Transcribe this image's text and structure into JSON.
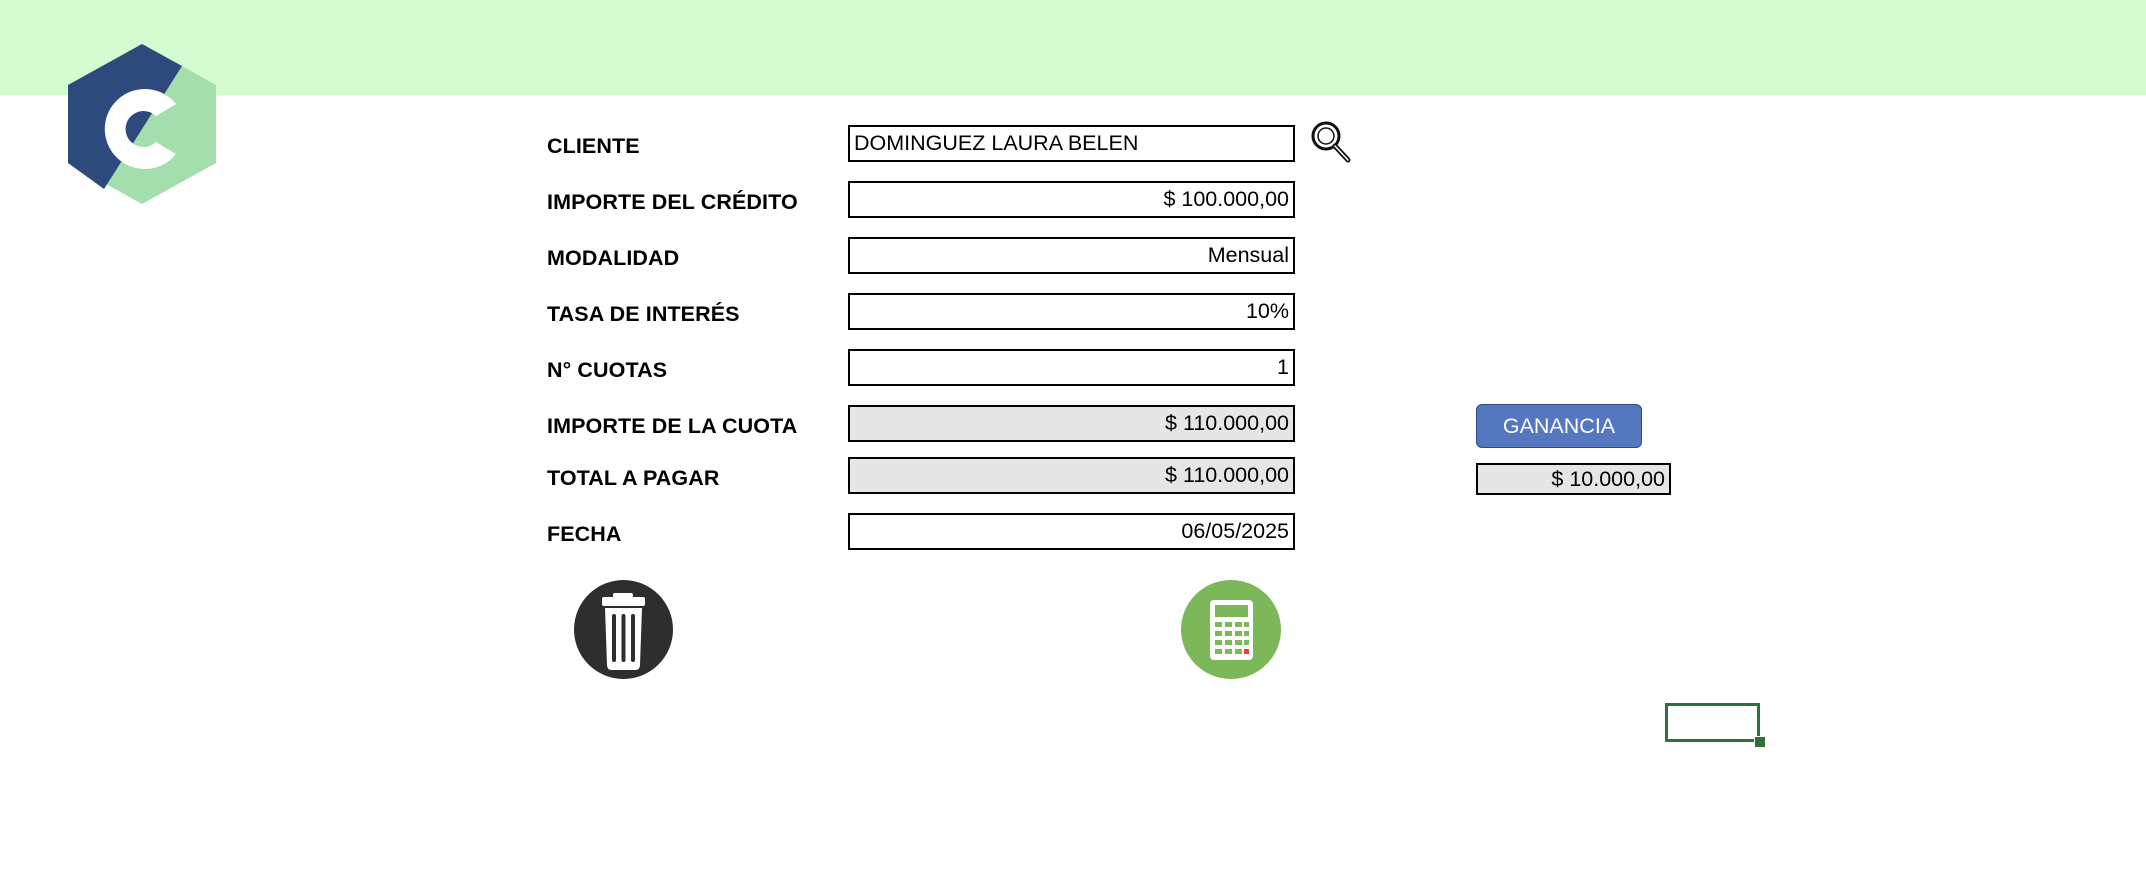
{
  "form": {
    "rows": [
      {
        "label": "CLIENTE",
        "value": "DOMINGUEZ LAURA BELEN"
      },
      {
        "label": "IMPORTE DEL CRÉDITO",
        "value": "$ 100.000,00"
      },
      {
        "label": "MODALIDAD",
        "value": "Mensual"
      },
      {
        "label": "TASA DE INTERÉS",
        "value": "10%"
      },
      {
        "label": "N° CUOTAS",
        "value": "1"
      },
      {
        "label": "IMPORTE DE LA CUOTA",
        "value": "$ 110.000,00"
      },
      {
        "label": "TOTAL A PAGAR",
        "value": "$ 110.000,00"
      },
      {
        "label": "FECHA",
        "value": "06/05/2025"
      }
    ]
  },
  "ganancia": {
    "button_label": "GANANCIA",
    "value": "$ 10.000,00"
  },
  "icons": {
    "logo": "c-hexagon-logo",
    "search": "magnifier-icon",
    "delete": "trash-icon",
    "calculate": "calculator-icon"
  },
  "colors": {
    "header_band": "#d5fcd0",
    "logo_dark": "#2d4a7c",
    "logo_light": "#a3deac",
    "button_blue": "#5577c0",
    "calc_green": "#7cb85a",
    "trash_dark": "#2e2e2e",
    "computed_cell": "#e6e6e6",
    "selection_green": "#2e7040"
  }
}
